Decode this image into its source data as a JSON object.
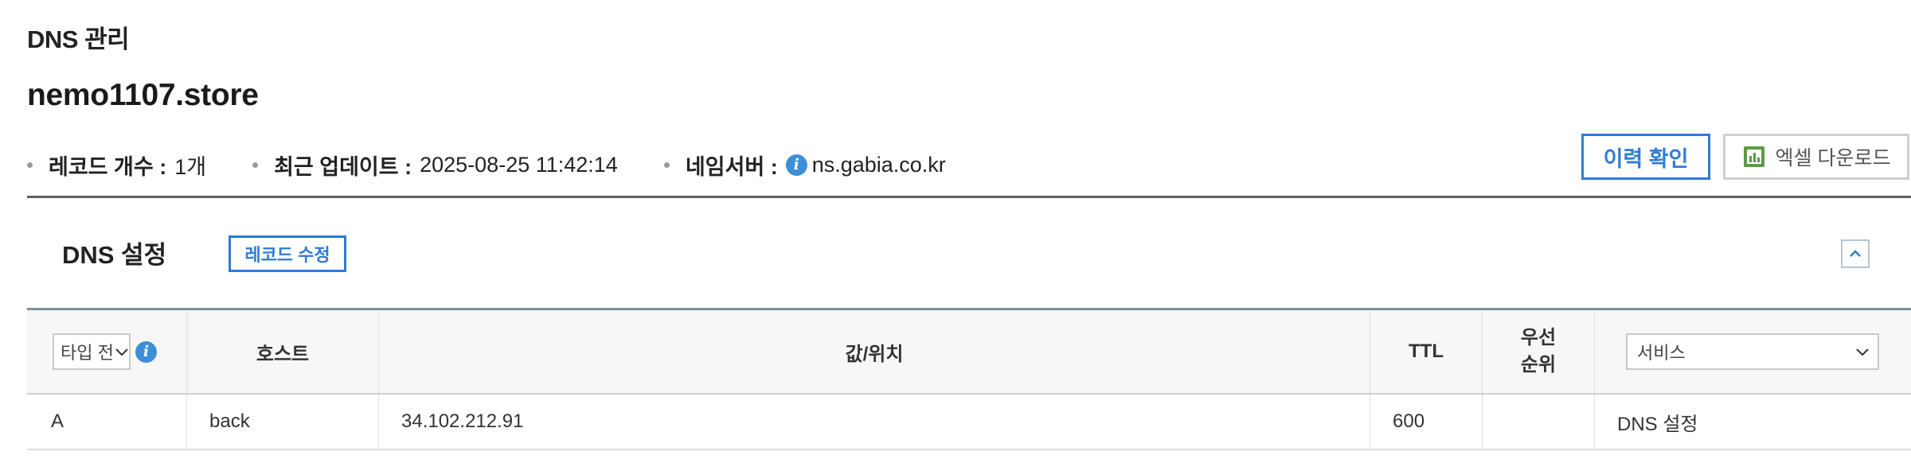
{
  "page": {
    "label": "DNS 관리",
    "domain": "nemo1107.store"
  },
  "info": {
    "records_label": "레코드 개수 :",
    "records_value": "1개",
    "updated_label": "최근 업데이트 :",
    "updated_value": "2025-08-25 11:42:14",
    "nameserver_label": "네임서버 :",
    "nameserver_value": "ns.gabia.co.kr"
  },
  "actions": {
    "history_label": "이력 확인",
    "excel_label": "엑셀 다운로드"
  },
  "dns_section": {
    "title": "DNS 설정",
    "edit_label": "레코드 수정"
  },
  "table": {
    "type_filter": "타입 전",
    "headers": {
      "host": "호스트",
      "value": "값/위치",
      "ttl": "TTL",
      "priority_line1": "우선",
      "priority_line2": "순위"
    },
    "service_filter": "서비스",
    "rows": [
      {
        "type": "A",
        "host": "back",
        "value": "34.102.212.91",
        "ttl": "600",
        "priority": "",
        "service": "DNS 설정"
      }
    ]
  },
  "colors": {
    "accent": "#2d7cd6",
    "info_icon": "#3c8fd6",
    "excel_icon": "#5b9b46"
  },
  "icons": {
    "info": "info-icon",
    "excel": "excel-chart-icon",
    "collapse": "chevron-up-icon",
    "dropdown": "chevron-down-icon"
  }
}
